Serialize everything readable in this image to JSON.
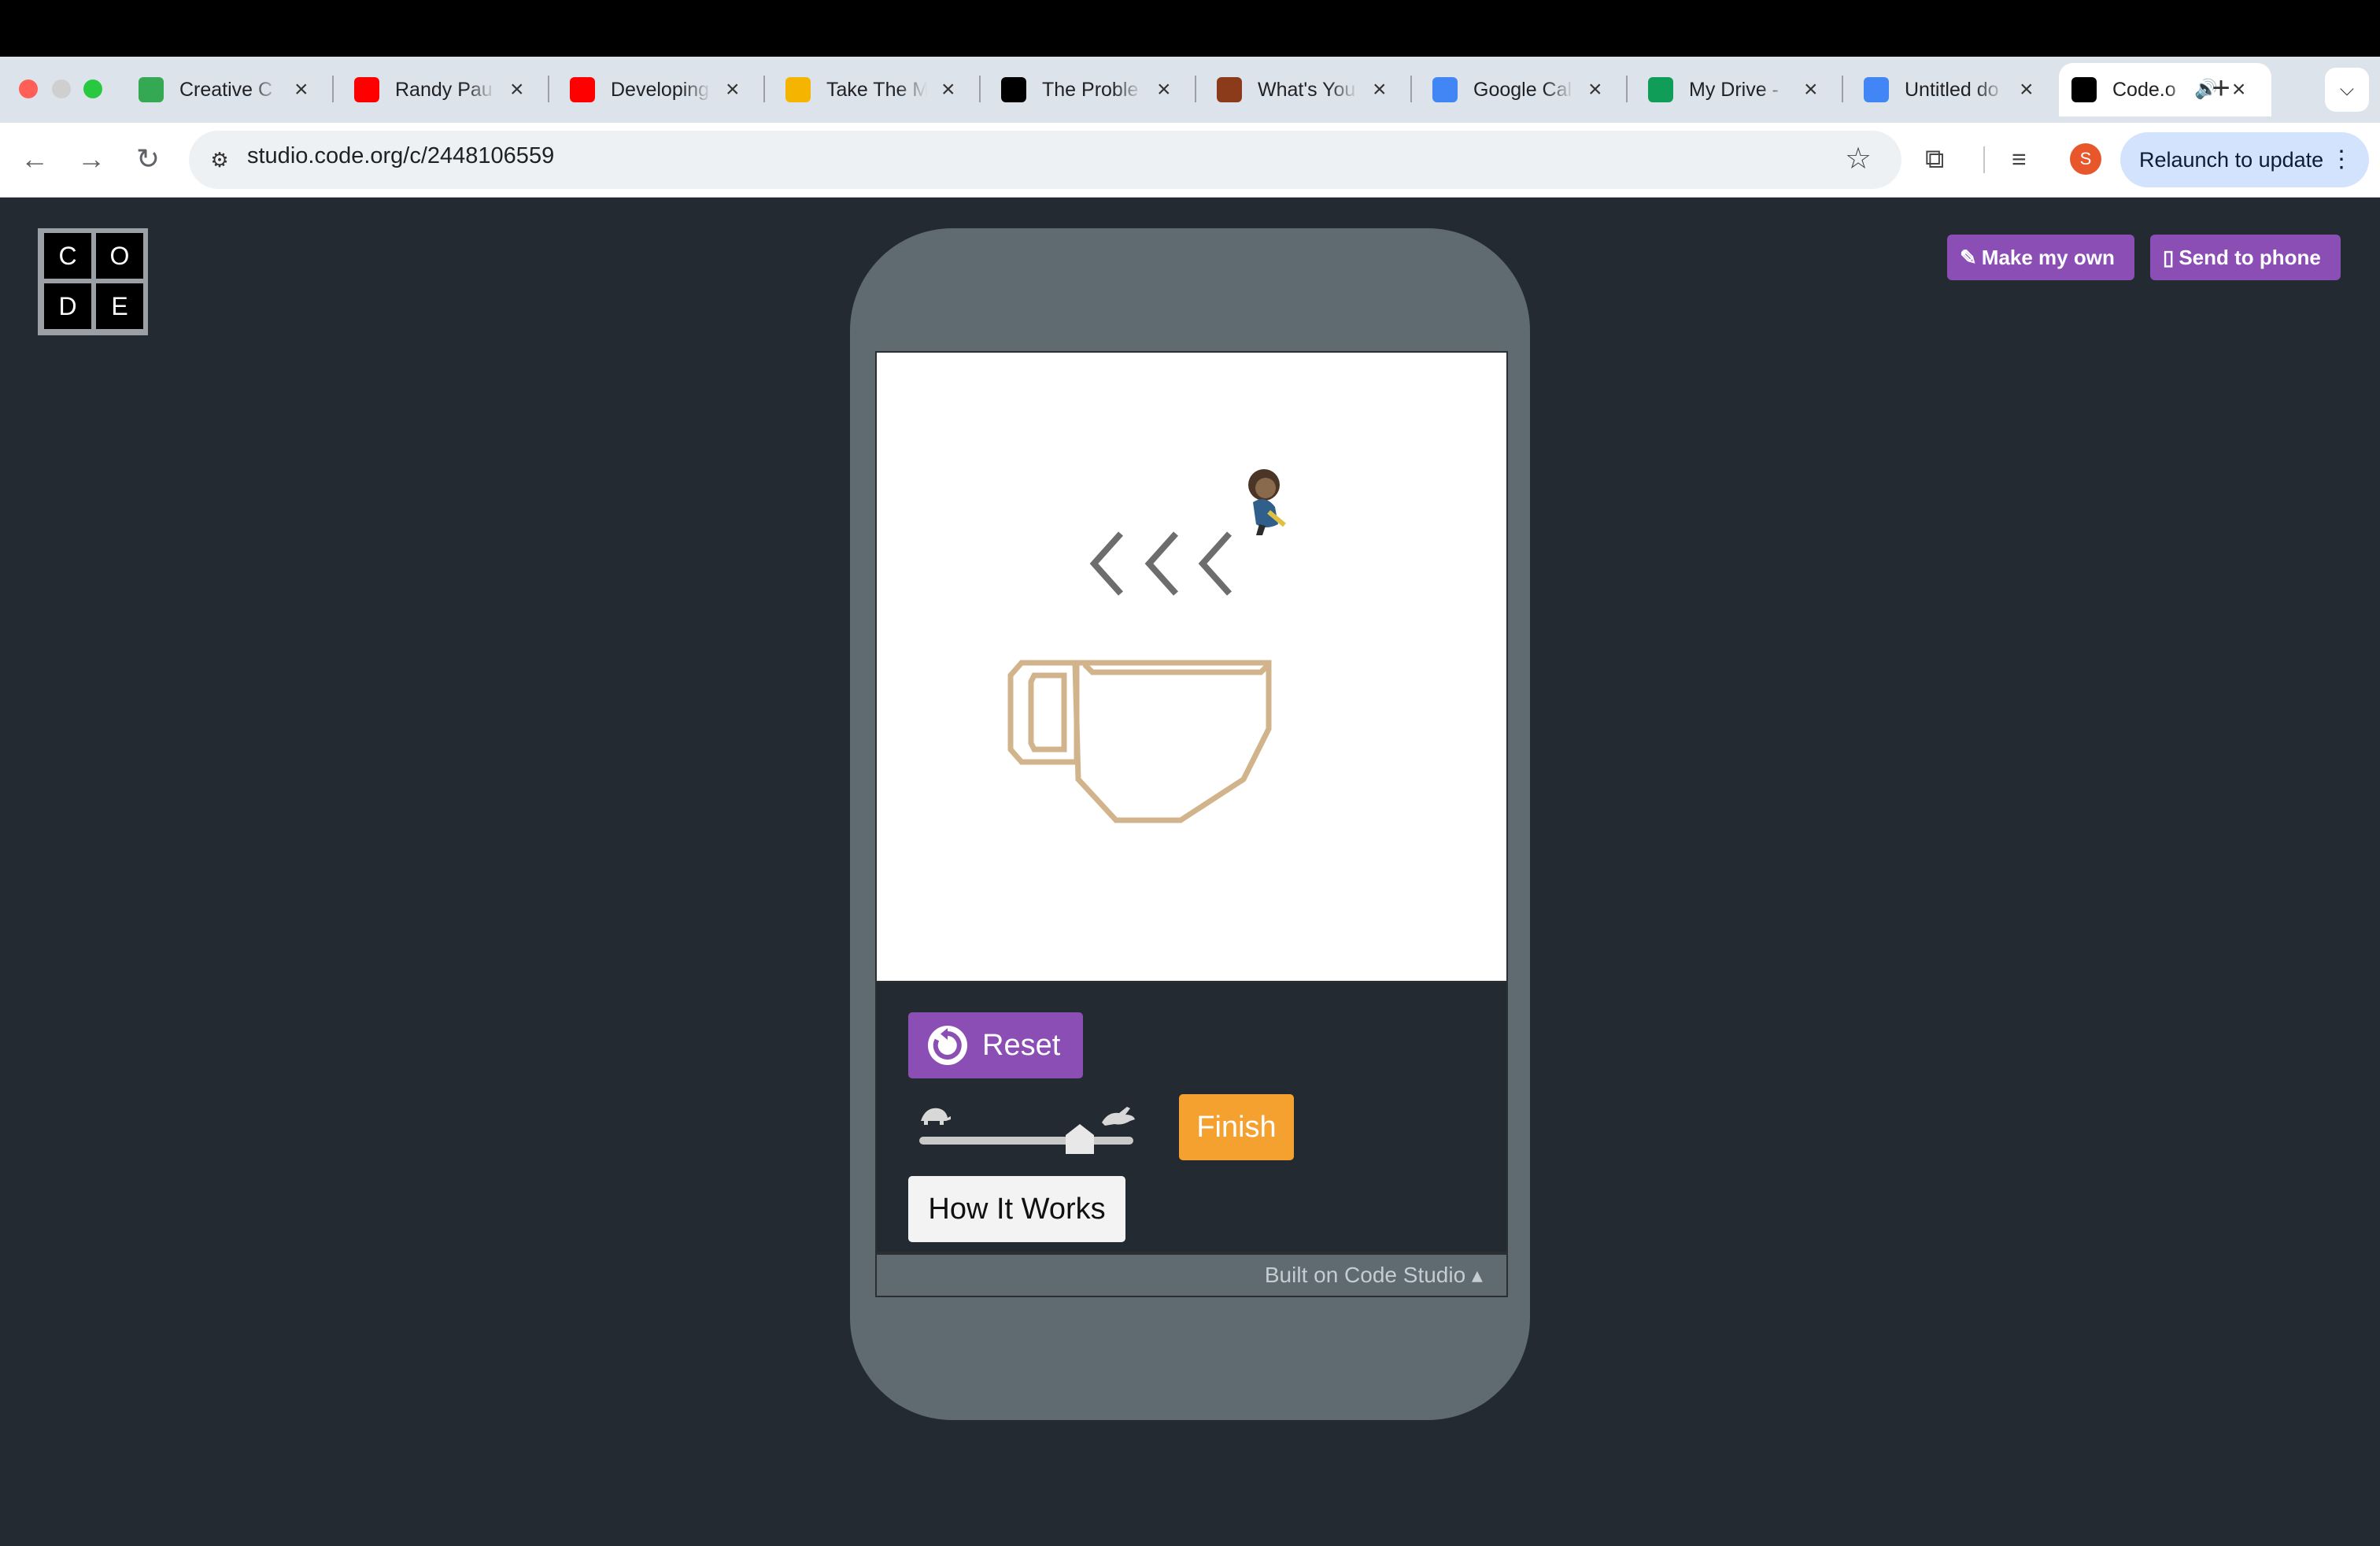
{
  "browser": {
    "tabs": [
      {
        "title": "Creative C",
        "favicon": "drive-multicolor-icon",
        "favicon_color": "#34a853"
      },
      {
        "title": "Randy Pau",
        "favicon": "youtube-icon",
        "favicon_color": "#ff0000"
      },
      {
        "title": "Developing",
        "favicon": "youtube-icon",
        "favicon_color": "#ff0000"
      },
      {
        "title": "Take The M",
        "favicon": "lightbulb-icon",
        "favicon_color": "#f4b400"
      },
      {
        "title": "The Proble",
        "favicon": "sciam-icon",
        "favicon_color": "#000000"
      },
      {
        "title": "What's You",
        "favicon": "quiz-icon",
        "favicon_color": "#8b3a1a"
      },
      {
        "title": "Google Cal",
        "favicon": "google-icon",
        "favicon_color": "#4285f4"
      },
      {
        "title": "My Drive -",
        "favicon": "google-drive-icon",
        "favicon_color": "#0f9d58"
      },
      {
        "title": "Untitled do",
        "favicon": "google-docs-icon",
        "favicon_color": "#4285f4"
      },
      {
        "title": "Code.o",
        "favicon": "code-org-icon",
        "favicon_color": "#000000",
        "active": true,
        "audio": true
      }
    ],
    "new_tab": "+",
    "url": "studio.code.org/c/2448106559",
    "profile_initial": "S",
    "relaunch_label": "Relaunch to update"
  },
  "page": {
    "logo_letters": [
      "C",
      "O",
      "D",
      "E"
    ],
    "make_own_label": "Make my own",
    "send_phone_label": "Send to phone",
    "reset_label": "Reset",
    "finish_label": "Finish",
    "how_label": "How It Works",
    "built_on_label": "Built on Code Studio ▴",
    "speed_level": 0.75,
    "colors": {
      "purple": "#8b4eb5",
      "orange": "#f5a130",
      "background": "#232a31",
      "phone_frame": "#5f6a71",
      "cup_stroke": "#d2b48c",
      "steam_stroke": "#6d6d6d"
    }
  }
}
